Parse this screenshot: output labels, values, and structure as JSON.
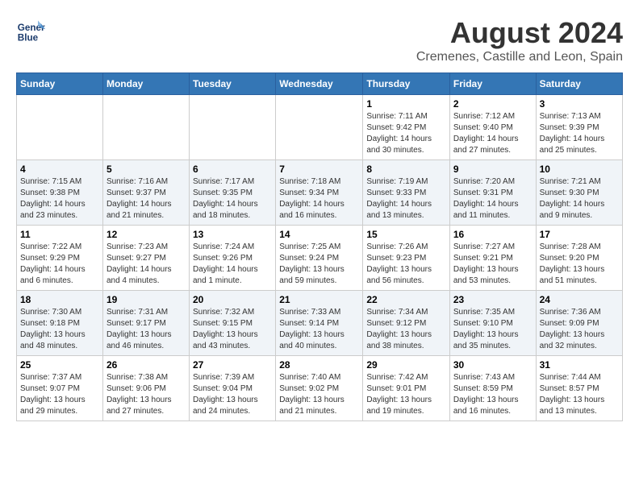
{
  "header": {
    "logo_line1": "General",
    "logo_line2": "Blue",
    "main_title": "August 2024",
    "subtitle": "Cremenes, Castille and Leon, Spain"
  },
  "calendar": {
    "headers": [
      "Sunday",
      "Monday",
      "Tuesday",
      "Wednesday",
      "Thursday",
      "Friday",
      "Saturday"
    ],
    "weeks": [
      [
        {
          "day": "",
          "info": ""
        },
        {
          "day": "",
          "info": ""
        },
        {
          "day": "",
          "info": ""
        },
        {
          "day": "",
          "info": ""
        },
        {
          "day": "1",
          "info": "Sunrise: 7:11 AM\nSunset: 9:42 PM\nDaylight: 14 hours\nand 30 minutes."
        },
        {
          "day": "2",
          "info": "Sunrise: 7:12 AM\nSunset: 9:40 PM\nDaylight: 14 hours\nand 27 minutes."
        },
        {
          "day": "3",
          "info": "Sunrise: 7:13 AM\nSunset: 9:39 PM\nDaylight: 14 hours\nand 25 minutes."
        }
      ],
      [
        {
          "day": "4",
          "info": "Sunrise: 7:15 AM\nSunset: 9:38 PM\nDaylight: 14 hours\nand 23 minutes."
        },
        {
          "day": "5",
          "info": "Sunrise: 7:16 AM\nSunset: 9:37 PM\nDaylight: 14 hours\nand 21 minutes."
        },
        {
          "day": "6",
          "info": "Sunrise: 7:17 AM\nSunset: 9:35 PM\nDaylight: 14 hours\nand 18 minutes."
        },
        {
          "day": "7",
          "info": "Sunrise: 7:18 AM\nSunset: 9:34 PM\nDaylight: 14 hours\nand 16 minutes."
        },
        {
          "day": "8",
          "info": "Sunrise: 7:19 AM\nSunset: 9:33 PM\nDaylight: 14 hours\nand 13 minutes."
        },
        {
          "day": "9",
          "info": "Sunrise: 7:20 AM\nSunset: 9:31 PM\nDaylight: 14 hours\nand 11 minutes."
        },
        {
          "day": "10",
          "info": "Sunrise: 7:21 AM\nSunset: 9:30 PM\nDaylight: 14 hours\nand 9 minutes."
        }
      ],
      [
        {
          "day": "11",
          "info": "Sunrise: 7:22 AM\nSunset: 9:29 PM\nDaylight: 14 hours\nand 6 minutes."
        },
        {
          "day": "12",
          "info": "Sunrise: 7:23 AM\nSunset: 9:27 PM\nDaylight: 14 hours\nand 4 minutes."
        },
        {
          "day": "13",
          "info": "Sunrise: 7:24 AM\nSunset: 9:26 PM\nDaylight: 14 hours\nand 1 minute."
        },
        {
          "day": "14",
          "info": "Sunrise: 7:25 AM\nSunset: 9:24 PM\nDaylight: 13 hours\nand 59 minutes."
        },
        {
          "day": "15",
          "info": "Sunrise: 7:26 AM\nSunset: 9:23 PM\nDaylight: 13 hours\nand 56 minutes."
        },
        {
          "day": "16",
          "info": "Sunrise: 7:27 AM\nSunset: 9:21 PM\nDaylight: 13 hours\nand 53 minutes."
        },
        {
          "day": "17",
          "info": "Sunrise: 7:28 AM\nSunset: 9:20 PM\nDaylight: 13 hours\nand 51 minutes."
        }
      ],
      [
        {
          "day": "18",
          "info": "Sunrise: 7:30 AM\nSunset: 9:18 PM\nDaylight: 13 hours\nand 48 minutes."
        },
        {
          "day": "19",
          "info": "Sunrise: 7:31 AM\nSunset: 9:17 PM\nDaylight: 13 hours\nand 46 minutes."
        },
        {
          "day": "20",
          "info": "Sunrise: 7:32 AM\nSunset: 9:15 PM\nDaylight: 13 hours\nand 43 minutes."
        },
        {
          "day": "21",
          "info": "Sunrise: 7:33 AM\nSunset: 9:14 PM\nDaylight: 13 hours\nand 40 minutes."
        },
        {
          "day": "22",
          "info": "Sunrise: 7:34 AM\nSunset: 9:12 PM\nDaylight: 13 hours\nand 38 minutes."
        },
        {
          "day": "23",
          "info": "Sunrise: 7:35 AM\nSunset: 9:10 PM\nDaylight: 13 hours\nand 35 minutes."
        },
        {
          "day": "24",
          "info": "Sunrise: 7:36 AM\nSunset: 9:09 PM\nDaylight: 13 hours\nand 32 minutes."
        }
      ],
      [
        {
          "day": "25",
          "info": "Sunrise: 7:37 AM\nSunset: 9:07 PM\nDaylight: 13 hours\nand 29 minutes."
        },
        {
          "day": "26",
          "info": "Sunrise: 7:38 AM\nSunset: 9:06 PM\nDaylight: 13 hours\nand 27 minutes."
        },
        {
          "day": "27",
          "info": "Sunrise: 7:39 AM\nSunset: 9:04 PM\nDaylight: 13 hours\nand 24 minutes."
        },
        {
          "day": "28",
          "info": "Sunrise: 7:40 AM\nSunset: 9:02 PM\nDaylight: 13 hours\nand 21 minutes."
        },
        {
          "day": "29",
          "info": "Sunrise: 7:42 AM\nSunset: 9:01 PM\nDaylight: 13 hours\nand 19 minutes."
        },
        {
          "day": "30",
          "info": "Sunrise: 7:43 AM\nSunset: 8:59 PM\nDaylight: 13 hours\nand 16 minutes."
        },
        {
          "day": "31",
          "info": "Sunrise: 7:44 AM\nSunset: 8:57 PM\nDaylight: 13 hours\nand 13 minutes."
        }
      ]
    ]
  }
}
